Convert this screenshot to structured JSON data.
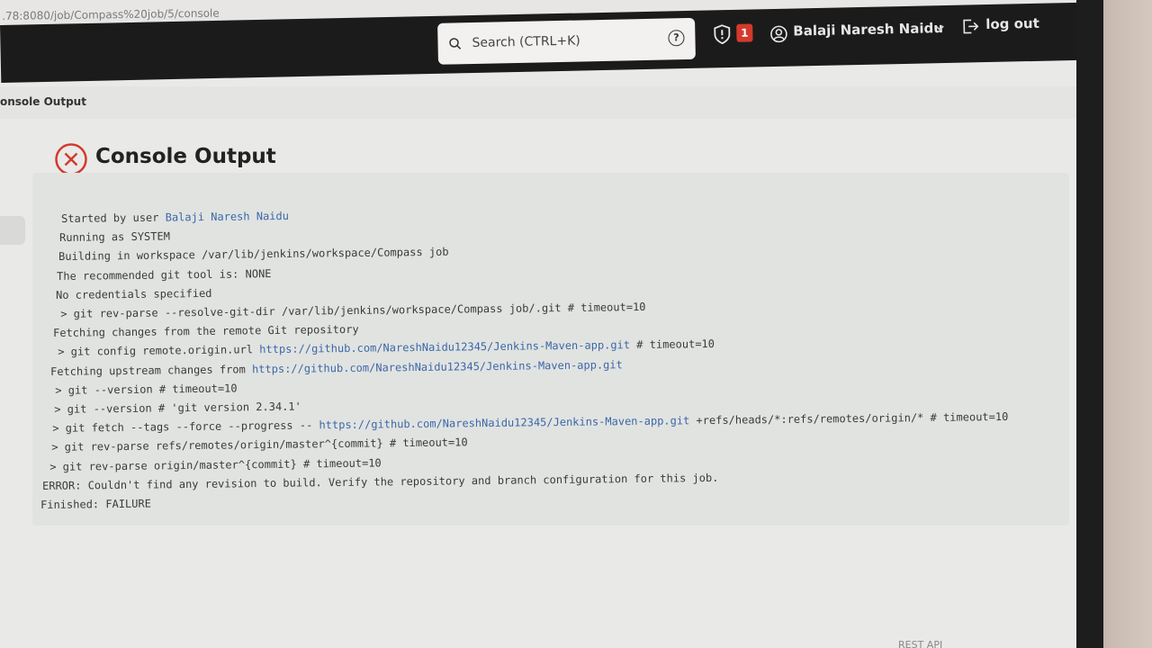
{
  "browser": {
    "url": ".78:8080/job/Compass%20job/5/console"
  },
  "header": {
    "search_placeholder": "Search (CTRL+K)",
    "help_label": "?",
    "security_badge_count": "1",
    "username": "Balaji Naresh Naidu",
    "logout_label": "log out"
  },
  "breadcrumb": {
    "current": "onsole Output"
  },
  "page": {
    "title": "Console Output"
  },
  "console": {
    "lines": [
      {
        "prefix": "Started by user ",
        "link": "Balaji Naresh Naidu",
        "suffix": ""
      },
      {
        "prefix": "Running as SYSTEM",
        "link": "",
        "suffix": ""
      },
      {
        "prefix": "Building in workspace /var/lib/jenkins/workspace/Compass job",
        "link": "",
        "suffix": ""
      },
      {
        "prefix": "The recommended git tool is: NONE",
        "link": "",
        "suffix": ""
      },
      {
        "prefix": "No credentials specified",
        "link": "",
        "suffix": ""
      },
      {
        "prefix": " > git rev-parse --resolve-git-dir /var/lib/jenkins/workspace/Compass job/.git # timeout=10",
        "link": "",
        "suffix": ""
      },
      {
        "prefix": "Fetching changes from the remote Git repository",
        "link": "",
        "suffix": ""
      },
      {
        "prefix": " > git config remote.origin.url ",
        "link": "https://github.com/NareshNaidu12345/Jenkins-Maven-app.git",
        "suffix": " # timeout=10"
      },
      {
        "prefix": "Fetching upstream changes from ",
        "link": "https://github.com/NareshNaidu12345/Jenkins-Maven-app.git",
        "suffix": ""
      },
      {
        "prefix": " > git --version # timeout=10",
        "link": "",
        "suffix": ""
      },
      {
        "prefix": " > git --version # 'git version 2.34.1'",
        "link": "",
        "suffix": ""
      },
      {
        "prefix": " > git fetch --tags --force --progress -- ",
        "link": "https://github.com/NareshNaidu12345/Jenkins-Maven-app.git",
        "suffix": " +refs/heads/*:refs/remotes/origin/* # timeout=10"
      },
      {
        "prefix": " > git rev-parse refs/remotes/origin/master^{commit} # timeout=10",
        "link": "",
        "suffix": ""
      },
      {
        "prefix": " > git rev-parse origin/master^{commit} # timeout=10",
        "link": "",
        "suffix": ""
      },
      {
        "prefix": "ERROR: Couldn't find any revision to build. Verify the repository and branch configuration for this job.",
        "link": "",
        "suffix": ""
      },
      {
        "prefix": "Finished: FAILURE",
        "link": "",
        "suffix": ""
      }
    ]
  },
  "footer": {
    "rest_api": "REST API"
  },
  "colors": {
    "header_bg": "#1c1b1c",
    "badge": "#d33a2c",
    "fail": "#d33a2c",
    "link": "#3b67a8"
  }
}
